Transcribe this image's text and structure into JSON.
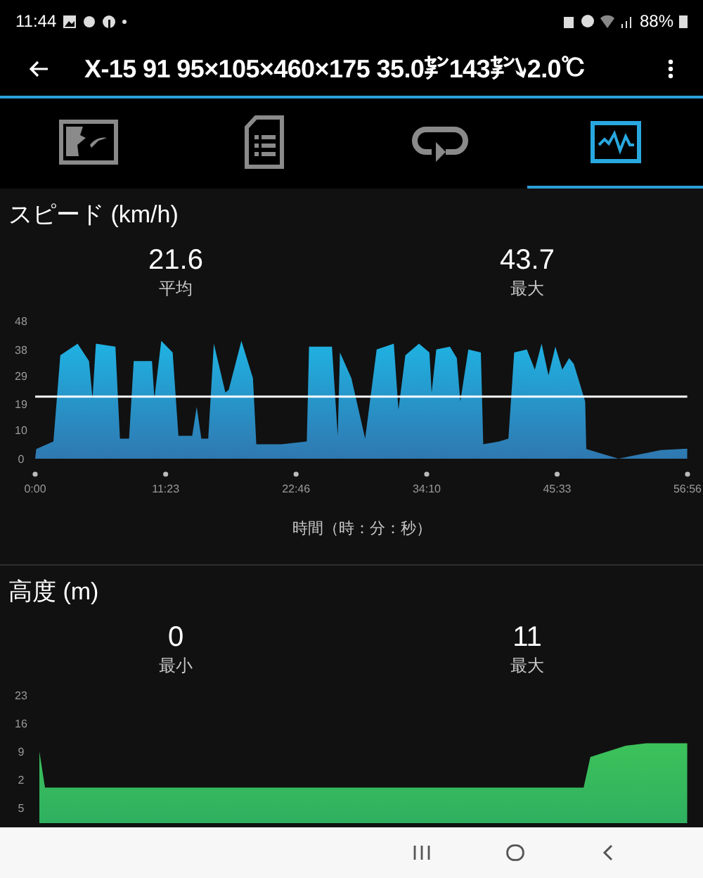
{
  "status_bar": {
    "time": "11:44",
    "battery": "88%"
  },
  "app_bar": {
    "title": "X-15 91 95×105×460×175 35.0㌢143㌢↘2.0℃"
  },
  "tabs": [
    {
      "kind": "map",
      "selected": false
    },
    {
      "kind": "list",
      "selected": false
    },
    {
      "kind": "laps",
      "selected": false
    },
    {
      "kind": "graph",
      "selected": true
    }
  ],
  "speed": {
    "title": "スピード (km/h)",
    "stats": [
      {
        "value": "21.6",
        "label": "平均"
      },
      {
        "value": "43.7",
        "label": "最大"
      }
    ],
    "chart_data": {
      "type": "area",
      "xlabel": "時間（時：分：秒）",
      "xlim": [
        0,
        56.93
      ],
      "ylim": [
        0,
        48
      ],
      "x": [
        0,
        0.1,
        1.6,
        2.2,
        3.7,
        4.7,
        5.0,
        5.3,
        7.0,
        7.4,
        8.2,
        8.6,
        10.2,
        10.4,
        11.0,
        12.0,
        12.5,
        13.7,
        14.1,
        14.5,
        15.1,
        15.6,
        16.6,
        16.9,
        18.0,
        19.0,
        19.3,
        21.5,
        23.7,
        23.9,
        25.9,
        26.4,
        26.6,
        27.6,
        28.8,
        29.8,
        31.3,
        31.7,
        32.3,
        33.5,
        34.4,
        34.6,
        35.0,
        36.2,
        36.8,
        37.1,
        37.8,
        38.9,
        39.1,
        40.5,
        41.3,
        41.8,
        42.9,
        43.6,
        44.2,
        44.8,
        45.4,
        46.0,
        46.6,
        47.0,
        48.0,
        48.1,
        50.9,
        52.1,
        54.6,
        56.9
      ],
      "series": [
        {
          "color": "#1fb3e3",
          "values": [
            0,
            3.4,
            6,
            36,
            40,
            34,
            21,
            40,
            39,
            7,
            7,
            34,
            34,
            21,
            41,
            37,
            8,
            8,
            18,
            7,
            7,
            40,
            23,
            24,
            41,
            28,
            5,
            5,
            6,
            39,
            39,
            8,
            37,
            28,
            7,
            38,
            40,
            17,
            36,
            40,
            37,
            23,
            38,
            39,
            35,
            20,
            38,
            37,
            5,
            6,
            7,
            37,
            38,
            31,
            40,
            29,
            39,
            31,
            35,
            33,
            20,
            3.4,
            0,
            1,
            3,
            3.5
          ]
        },
        {
          "type": "line",
          "color": "#ffffff",
          "values": [
            21.6,
            21.6,
            21.6,
            21.6,
            21.6,
            21.6,
            21.6,
            21.6,
            21.6,
            21.6,
            21.6,
            21.6,
            21.6,
            21.6,
            21.6,
            21.6,
            21.6,
            21.6,
            21.6,
            21.6,
            21.6,
            21.6,
            21.6,
            21.6,
            21.6,
            21.6,
            21.6,
            21.6,
            21.6,
            21.6,
            21.6,
            21.6,
            21.6,
            21.6,
            21.6,
            21.6,
            21.6,
            21.6,
            21.6,
            21.6,
            21.6,
            21.6,
            21.6,
            21.6,
            21.6,
            21.6,
            21.6,
            21.6,
            21.6,
            21.6,
            21.6,
            21.6,
            21.6,
            21.6,
            21.6,
            21.6,
            21.6,
            21.6,
            21.6,
            21.6,
            21.6,
            21.6,
            21.6,
            21.6,
            21.6,
            21.6
          ]
        }
      ],
      "yticks": [
        {
          "value": 0,
          "label": "0"
        },
        {
          "value": 10,
          "label": "10"
        },
        {
          "value": 19,
          "label": "19"
        },
        {
          "value": 29,
          "label": "29"
        },
        {
          "value": 38,
          "label": "38"
        },
        {
          "value": 48,
          "label": "48"
        }
      ],
      "xticks": [
        {
          "value": 0,
          "label": "0:00"
        },
        {
          "value": 11.39,
          "label": "11:23"
        },
        {
          "value": 22.77,
          "label": "22:46"
        },
        {
          "value": 34.17,
          "label": "34:10"
        },
        {
          "value": 45.55,
          "label": "45:33"
        },
        {
          "value": 56.93,
          "label": "56:56"
        }
      ],
      "stacked": false
    }
  },
  "altitude": {
    "title": "高度 (m)",
    "stats": [
      {
        "value": "0",
        "label": "最小"
      },
      {
        "value": "11",
        "label": "最大"
      }
    ],
    "chart_data": {
      "type": "area",
      "xlim": [
        0,
        56.93
      ],
      "ylim": [
        -5,
        23
      ],
      "x": [
        0,
        0.5,
        47.8,
        48.4,
        51.5,
        53.3,
        56.9
      ],
      "series": [
        {
          "color": "#3cc25a",
          "values": [
            9,
            0,
            0,
            7.6,
            10.4,
            11,
            11
          ]
        }
      ],
      "yticks": [
        {
          "value": 23,
          "label": "23"
        },
        {
          "value": 16,
          "label": "16"
        },
        {
          "value": 9,
          "label": "9"
        },
        {
          "value": 2,
          "label": "2"
        },
        {
          "value": -5,
          "label": "5"
        }
      ]
    }
  }
}
